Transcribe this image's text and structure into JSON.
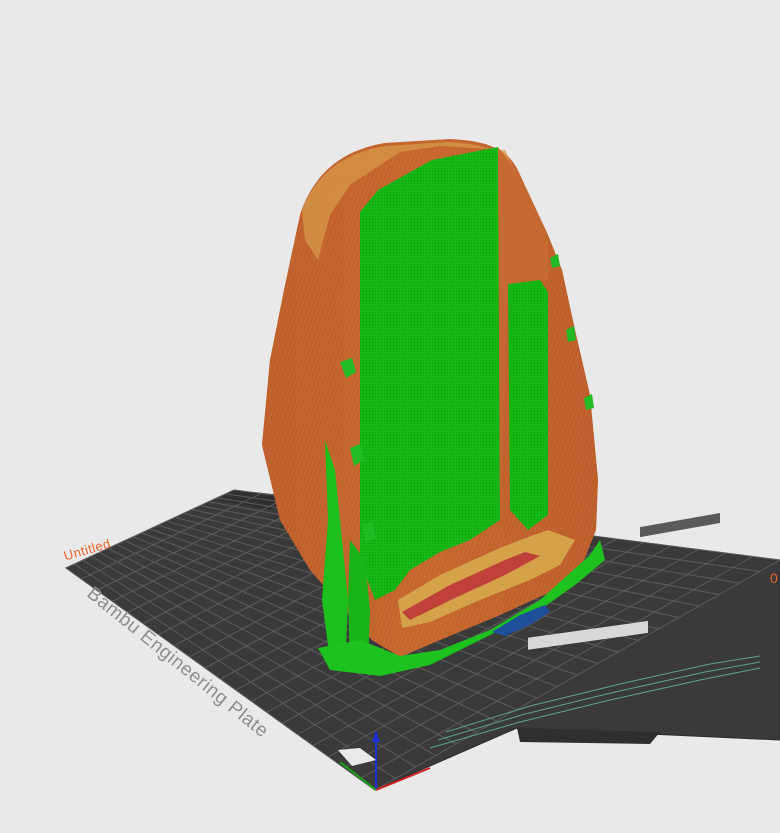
{
  "plate": {
    "name": "Untitled",
    "number": "0",
    "label": "Bambu Engineering Plate"
  },
  "colors": {
    "background": "#e9e9e9",
    "plate": "#3c3c3c",
    "grid": "#5a5a5a",
    "plate_name": "#e8622a",
    "wall": "#c2632d",
    "wall_highlight": "#d79a45",
    "infill": "#14b514",
    "support": "#1ec21e",
    "bridge": "#c23c3c",
    "axis_x": "#d02020",
    "axis_y": "#18a018",
    "axis_z": "#2030d0"
  },
  "icons": {
    "axes": "xyz-axes-icon"
  }
}
